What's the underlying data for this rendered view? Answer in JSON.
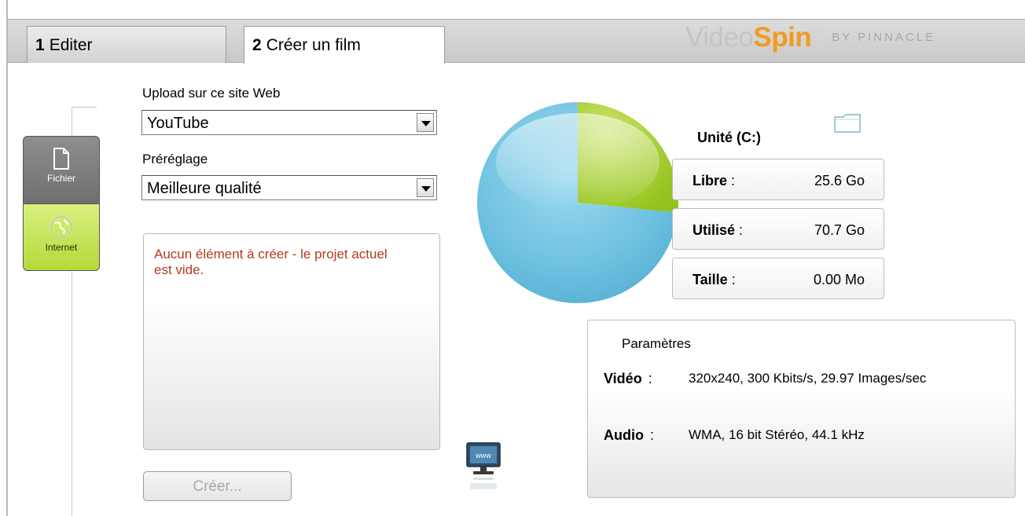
{
  "tabs": {
    "edit": {
      "num": "1",
      "label": "Editer"
    },
    "create": {
      "num": "2",
      "label": "Créer un film"
    }
  },
  "logo": {
    "part1": "Video",
    "part2": "Spin",
    "byline": "BY PINNACLE"
  },
  "side_nav": {
    "file": {
      "label": "Fichier",
      "icon": "document-icon"
    },
    "internet": {
      "label": "Internet",
      "icon": "globe-icon"
    }
  },
  "upload": {
    "site_label": "Upload sur ce site Web",
    "site_value": "YouTube",
    "preset_label": "Préréglage",
    "preset_value": "Meilleure qualité"
  },
  "message": "Aucun élément à créer - le projet actuel est vide.",
  "create_button": "Créer...",
  "disk": {
    "drive_label": "Unité (C:)",
    "free_label": "Libre",
    "free_value": "25.6 Go",
    "used_label": "Utilisé",
    "used_value": "70.7 Go",
    "size_label": "Taille",
    "size_value": "0.00 Mo",
    "colon": ":",
    "free_fraction": 0.266,
    "colors": {
      "free": "#a6cd2c",
      "used": "#74c4e2"
    }
  },
  "params": {
    "title": "Paramètres",
    "video_label": "Vidéo",
    "video_value": "320x240, 300 Kbits/s, 29.97 Images/sec",
    "audio_label": "Audio",
    "audio_value": "WMA, 16 bit Stéréo, 44.1 kHz"
  }
}
